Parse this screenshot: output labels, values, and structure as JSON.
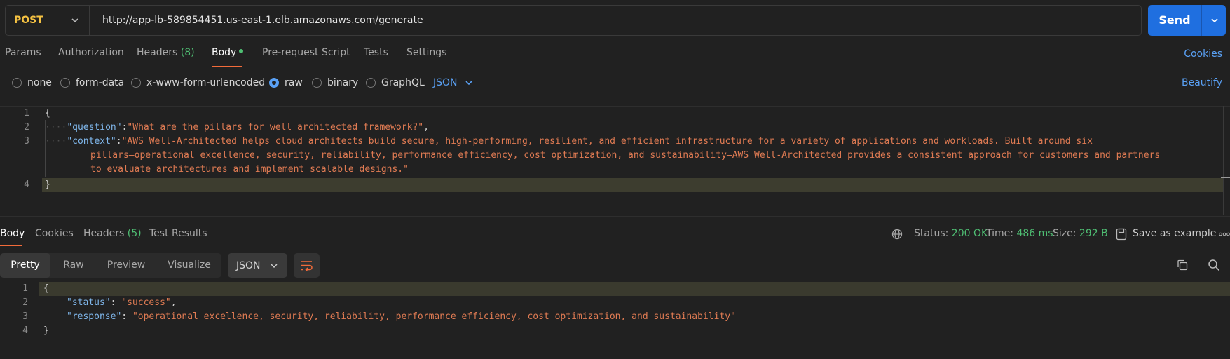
{
  "request": {
    "method": "POST",
    "url": "http://app-lb-589854451.us-east-1.elb.amazonaws.com/generate",
    "send_label": "Send",
    "tabs": [
      {
        "label": "Params"
      },
      {
        "label": "Authorization"
      },
      {
        "label": "Headers",
        "count": "(8)"
      },
      {
        "label": "Body"
      },
      {
        "label": "Pre-request Script"
      },
      {
        "label": "Tests"
      },
      {
        "label": "Settings"
      }
    ],
    "cookies_label": "Cookies",
    "body_types": [
      "none",
      "form-data",
      "x-www-form-urlencoded",
      "raw",
      "binary",
      "GraphQL"
    ],
    "body_format": "JSON",
    "beautify_label": "Beautify",
    "body_lines": {
      "l1": "{",
      "question_key": "\"question\"",
      "question_value": "\"What are the pillars for well architected framework?\"",
      "context_key": "\"context\"",
      "context_value_1": "\"AWS Well-Architected helps cloud architects build secure, high-performing, resilient, and efficient infrastructure for a variety of applications and workloads. Built around six",
      "context_value_2": "pillars—operational excellence, security, reliability, performance efficiency, cost optimization, and sustainability—AWS Well-Architected provides a consistent approach for customers and partners",
      "context_value_3": "to evaluate architectures and implement scalable designs.\"",
      "l4": "}"
    },
    "line_numbers": [
      "1",
      "2",
      "3",
      "4"
    ]
  },
  "response": {
    "tabs": [
      {
        "label": "Body"
      },
      {
        "label": "Cookies"
      },
      {
        "label": "Headers",
        "count": "(5)"
      },
      {
        "label": "Test Results"
      }
    ],
    "status_label": "Status:",
    "status_value": "200 OK",
    "time_label": "Time:",
    "time_value": "486 ms",
    "size_label": "Size:",
    "size_value": "292 B",
    "save_example_label": "Save as example",
    "view_modes": [
      "Pretty",
      "Raw",
      "Preview",
      "Visualize"
    ],
    "format": "JSON",
    "body_lines": {
      "l1": "{",
      "status_key": "\"status\"",
      "status_val": "\"success\"",
      "response_key": "\"response\"",
      "response_val": "\"operational excellence, security, reliability, performance efficiency, cost optimization, and sustainability\"",
      "l4": "}"
    },
    "line_numbers": [
      "1",
      "2",
      "3",
      "4"
    ]
  },
  "colors": {
    "accent": "#1f6fe0",
    "method": "#f5c242",
    "success": "#4fbe73",
    "link": "#5aa1f5",
    "tab_underline": "#f26b3a"
  }
}
